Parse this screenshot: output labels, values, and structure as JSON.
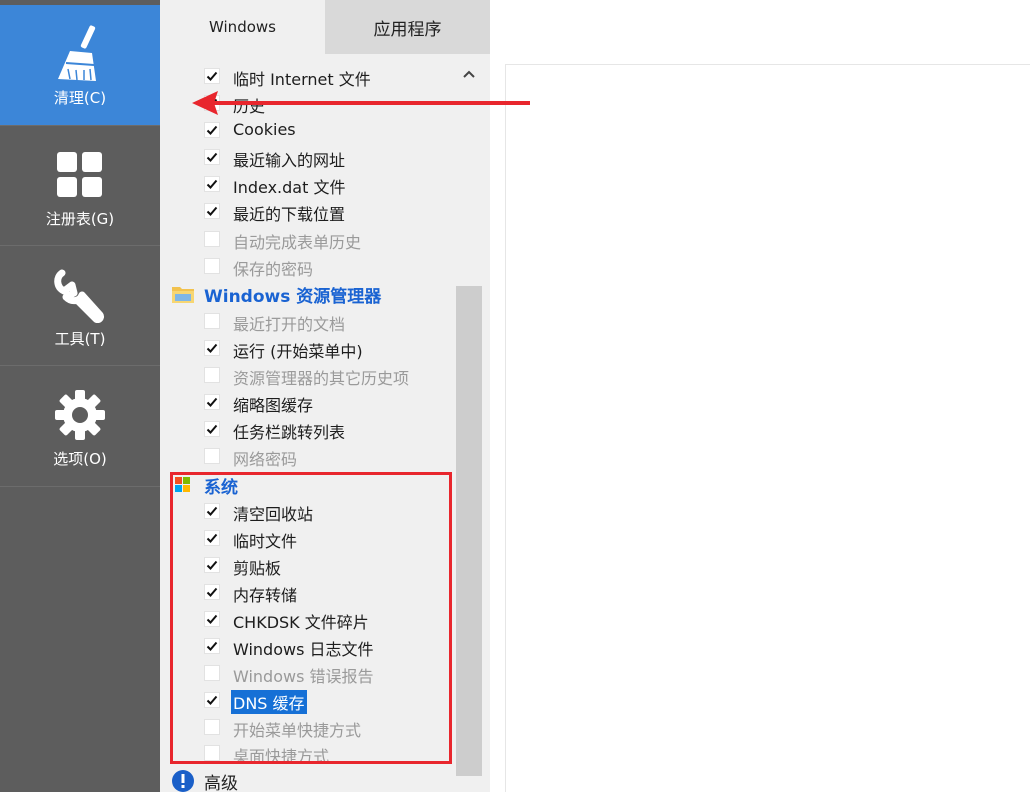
{
  "sidebar": {
    "items": [
      {
        "label": "清理(C)",
        "icon": "broom-icon"
      },
      {
        "label": "注册表(G)",
        "icon": "grid-icon"
      },
      {
        "label": "工具(T)",
        "icon": "wrench-icon"
      },
      {
        "label": "选项(O)",
        "icon": "gear-icon"
      }
    ]
  },
  "tabs": [
    {
      "label": "Windows"
    },
    {
      "label": "应用程序"
    }
  ],
  "tree": {
    "ie_items": [
      {
        "label": "临时 Internet 文件",
        "checked": true
      },
      {
        "label": "历史",
        "checked": true
      },
      {
        "label": "Cookies",
        "checked": true
      },
      {
        "label": "最近输入的网址",
        "checked": true
      },
      {
        "label": "Index.dat 文件",
        "checked": true
      },
      {
        "label": "最近的下载位置",
        "checked": true
      },
      {
        "label": "自动完成表单历史",
        "checked": false
      },
      {
        "label": "保存的密码",
        "checked": false
      }
    ],
    "explorer_group": {
      "label": "Windows 资源管理器",
      "icon": "folder-icon"
    },
    "explorer_items": [
      {
        "label": "最近打开的文档",
        "checked": false
      },
      {
        "label": "运行 (开始菜单中)",
        "checked": true
      },
      {
        "label": "资源管理器的其它历史项",
        "checked": false
      },
      {
        "label": "缩略图缓存",
        "checked": true
      },
      {
        "label": "任务栏跳转列表",
        "checked": true
      },
      {
        "label": "网络密码",
        "checked": false
      }
    ],
    "system_group": {
      "label": "系统",
      "icon": "windows-logo-icon"
    },
    "system_items": [
      {
        "label": "清空回收站",
        "checked": true
      },
      {
        "label": "临时文件",
        "checked": true
      },
      {
        "label": "剪贴板",
        "checked": true
      },
      {
        "label": "内存转储",
        "checked": true
      },
      {
        "label": "CHKDSK 文件碎片",
        "checked": true
      },
      {
        "label": "Windows 日志文件",
        "checked": true
      },
      {
        "label": "Windows 错误报告",
        "checked": false
      },
      {
        "label": "DNS 缓存",
        "checked": true,
        "selected": true
      },
      {
        "label": "开始菜单快捷方式",
        "checked": false
      },
      {
        "label": "桌面快捷方式",
        "checked": false
      }
    ],
    "advanced_group": {
      "label": "高级",
      "icon": "info-icon"
    }
  },
  "colors": {
    "sidebar_bg": "#5d5d5d",
    "active_nav": "#3c86d8",
    "group_text": "#1a63d2",
    "annotation_red": "#e8262d",
    "selection": "#1670d6"
  }
}
